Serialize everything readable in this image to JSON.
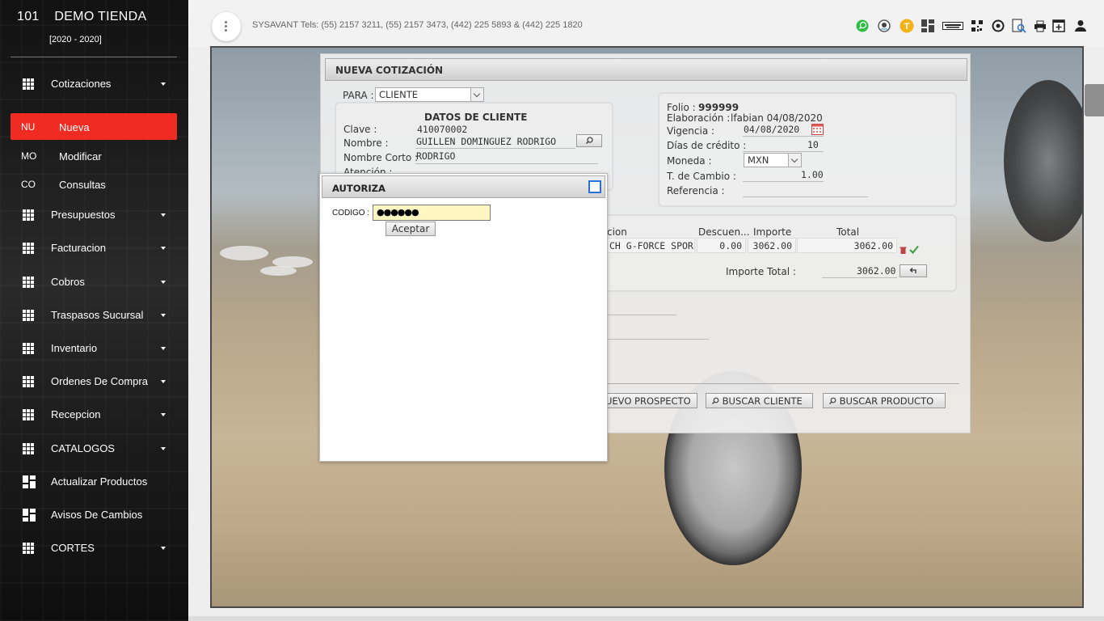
{
  "sidebar": {
    "store_number": "101",
    "store_name": "DEMO TIENDA",
    "years": "[2020 - 2020]",
    "menu": [
      {
        "label": "Cotizaciones",
        "icon": "grid-icon",
        "has_children": true
      },
      {
        "label": "Presupuestos",
        "icon": "grid-icon",
        "has_children": true
      },
      {
        "label": "Facturacion",
        "icon": "grid-icon",
        "has_children": true
      },
      {
        "label": "Cobros",
        "icon": "grid-icon",
        "has_children": true
      },
      {
        "label": "Traspasos Sucursal",
        "icon": "grid-icon",
        "has_children": true
      },
      {
        "label": "Inventario",
        "icon": "grid-icon",
        "has_children": true
      },
      {
        "label": "Ordenes De Compra",
        "icon": "grid-icon",
        "has_children": true
      },
      {
        "label": "Recepcion",
        "icon": "grid-icon",
        "has_children": true
      },
      {
        "label": "CATALOGOS",
        "icon": "grid-icon",
        "has_children": true
      },
      {
        "label": "Actualizar Productos",
        "icon": "dashboard-icon",
        "has_children": false
      },
      {
        "label": "Avisos De Cambios",
        "icon": "dashboard-icon",
        "has_children": false
      },
      {
        "label": "CORTES",
        "icon": "grid-icon",
        "has_children": true
      }
    ],
    "submenu": [
      {
        "abbr": "NU",
        "label": "Nueva",
        "active": true
      },
      {
        "abbr": "MO",
        "label": "Modificar",
        "active": false
      },
      {
        "abbr": "CO",
        "label": "Consultas",
        "active": false
      }
    ],
    "active_color": "#f02b22"
  },
  "topbar": {
    "contact": "SYSAVANT Tels: (55) 2157 3211, (55) 2157 3473, (442) 225 5893 & (442) 225 1820",
    "toolbar_icons": [
      "whatsapp-icon",
      "support-avatar-icon",
      "t-badge-icon",
      "dashboard-icon",
      "keyboard-icon",
      "qr-code-icon",
      "settings-icon",
      "document-search-icon",
      "printer-icon",
      "new-window-icon",
      "user-icon"
    ],
    "t_badge_label": "T"
  },
  "quote": {
    "title": "NUEVA COTIZACIÓN",
    "para_label": "PARA :",
    "para_value": "CLIENTE",
    "client_title": "DATOS DE CLIENTE",
    "clave_label": "Clave :",
    "clave_value": "410070002",
    "nombre_label": "Nombre :",
    "nombre_value": "GUILLEN DOMINGUEZ RODRIGO",
    "nombre_corto_label": "Nombre Corto :",
    "nombre_corto_value": "RODRIGO",
    "atencion_label": "Atención :",
    "folio_label": "Folio :",
    "folio_value": "999999",
    "elaboracion_label": "Elaboración :",
    "elaboracion_value": "lfabian 04/08/2020",
    "vigencia_label": "Vigencia :",
    "vigencia_value": "04/08/2020",
    "dias_credito_label": "Días de crédito :",
    "dias_credito_value": "10",
    "moneda_label": "Moneda :",
    "moneda_value": "MXN",
    "tipo_cambio_label": "T. de Cambio :",
    "tipo_cambio_value": "1.00",
    "referencia_label": "Referencia :",
    "table": {
      "headers": [
        "cion",
        "Descuen...",
        "Importe",
        "Total"
      ],
      "row": {
        "descripcion": "CH G-FORCE SPOR",
        "descuento": "0.00",
        "importe": "3062.00",
        "total": "3062.00"
      }
    },
    "importe_total_label": "Importe Total :",
    "importe_total_value": "3062.00",
    "buttons": {
      "nuevo_prospecto": "UEVO PROSPECTO",
      "buscar_cliente": "BUSCAR CLIENTE",
      "buscar_producto": "BUSCAR PRODUCTO"
    }
  },
  "authorize": {
    "title": "AUTORIZA",
    "code_label": "CODIGO :",
    "code_value": "●●●●●●",
    "accept_label": "Aceptar",
    "field_color": "#fff6c2"
  }
}
